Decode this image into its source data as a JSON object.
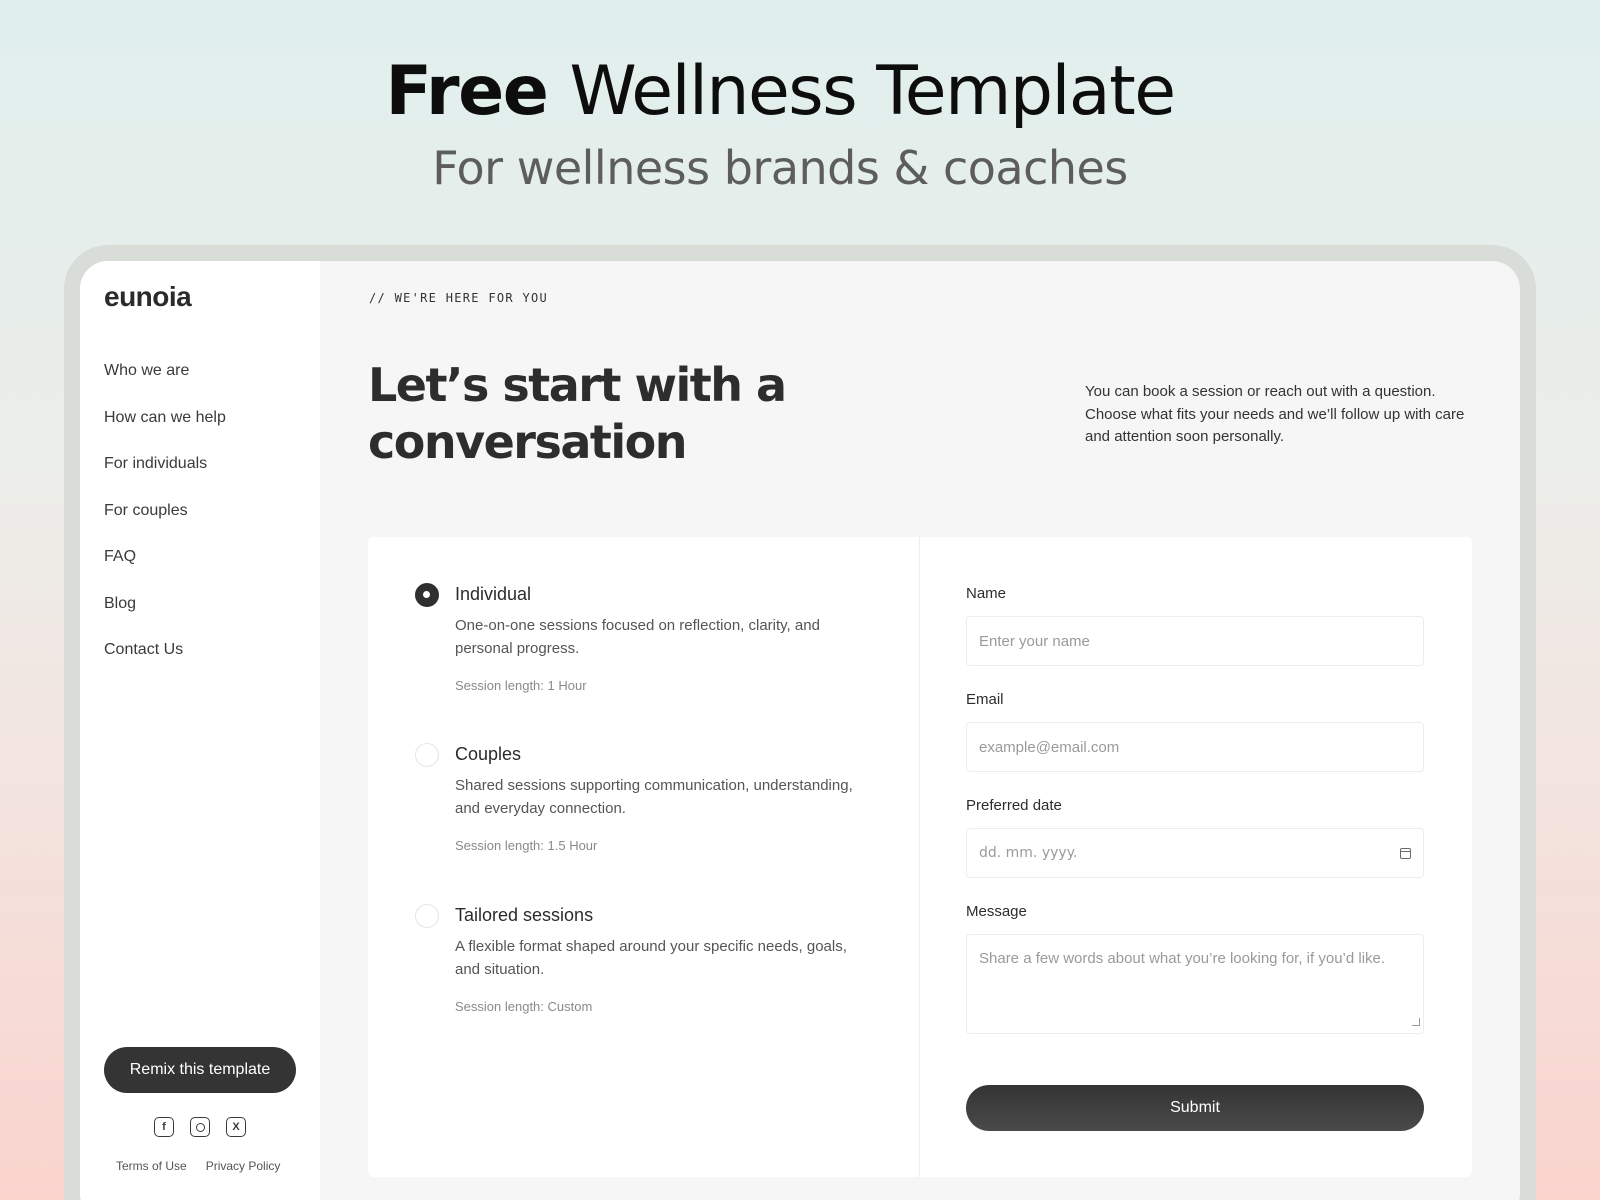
{
  "hero": {
    "title_strong": "Free",
    "title_light": "Wellness Template",
    "subtitle": "For wellness brands & coaches"
  },
  "sidebar": {
    "logo": "eunoia",
    "nav": [
      {
        "label": "Who we are"
      },
      {
        "label": "How can we help"
      },
      {
        "label": "For individuals"
      },
      {
        "label": "For couples"
      },
      {
        "label": "FAQ"
      },
      {
        "label": "Blog"
      },
      {
        "label": "Contact Us"
      }
    ],
    "remix_label": "Remix this template",
    "socials": {
      "facebook": "f",
      "x": "X"
    },
    "footer": {
      "terms": "Terms of Use",
      "privacy": "Privacy Policy"
    }
  },
  "main": {
    "eyebrow": "// WE'RE HERE FOR YOU",
    "headline": "Let’s start with a conversation",
    "intro": "You can book a session or reach out with a question. Choose what fits your needs and we’ll follow up with care and attention soon personally.",
    "options": [
      {
        "title": "Individual",
        "description": "One-on-one sessions focused on reflection, clarity, and personal progress.",
        "length": "Session length: 1 Hour",
        "selected": true
      },
      {
        "title": "Couples",
        "description": "Shared sessions supporting communication, understanding, and everyday connection.",
        "length": "Session length: 1.5 Hour",
        "selected": false
      },
      {
        "title": "Tailored sessions",
        "description": "A flexible format shaped around your specific needs, goals, and situation.",
        "length": "Session length: Custom",
        "selected": false
      }
    ],
    "form": {
      "name_label": "Name",
      "name_placeholder": "Enter your name",
      "email_label": "Email",
      "email_placeholder": "example@email.com",
      "date_label": "Preferred date",
      "date_placeholder": "dd. mm. yyyy.",
      "message_label": "Message",
      "message_placeholder": "Share a few words about what you’re looking for, if you’d like.",
      "submit_label": "Submit"
    }
  },
  "colors": {
    "dark_button": "#343434",
    "sidebar_bg": "#ffffff",
    "content_bg": "#f6f6f6"
  }
}
